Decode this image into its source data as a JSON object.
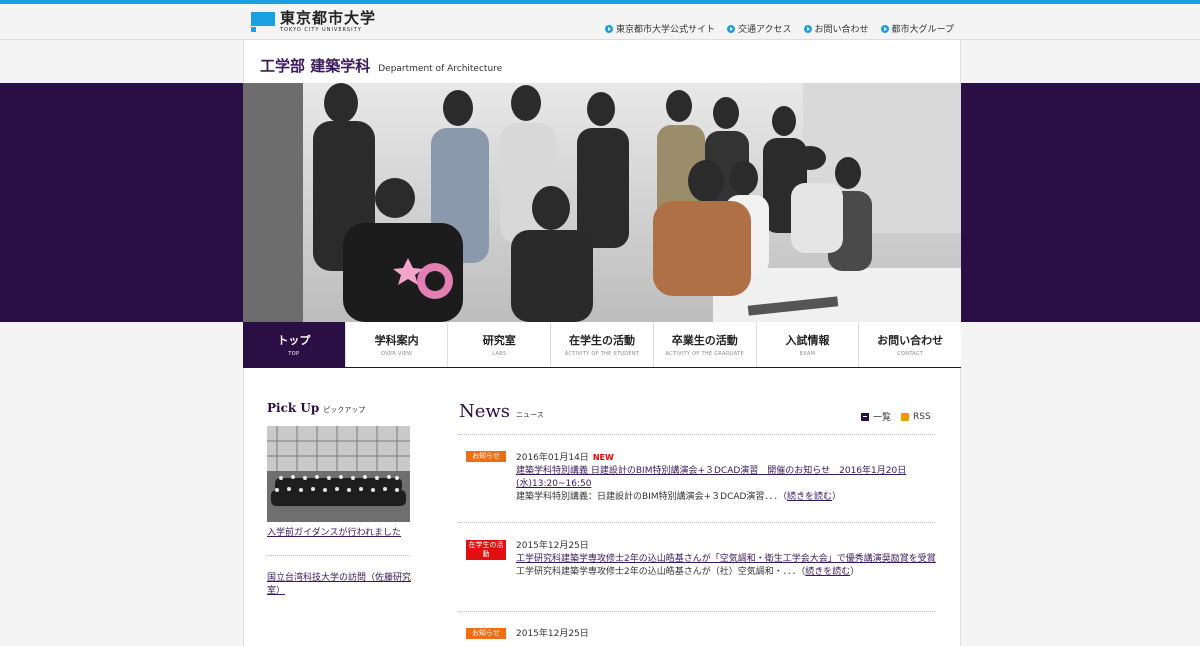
{
  "site": {
    "logo_jp": "東京都市大学",
    "logo_en": "TOKYO CITY UNIVERSITY",
    "top_links": [
      "東京都市大学公式サイト",
      "交通アクセス",
      "お問い合わせ",
      "都市大グループ"
    ]
  },
  "dept": {
    "title_jp": "工学部 建築学科",
    "title_en": "Department of Architecture"
  },
  "nav": [
    {
      "jp": "トップ",
      "en": "TOP"
    },
    {
      "jp": "学科案内",
      "en": "OVER VIEW"
    },
    {
      "jp": "研究室",
      "en": "LABS"
    },
    {
      "jp": "在学生の活動",
      "en": "ACTIVITY OF THE STUDENT"
    },
    {
      "jp": "卒業生の活動",
      "en": "ACTIVITY OF THE GRADUATE"
    },
    {
      "jp": "入試情報",
      "en": "EXAM"
    },
    {
      "jp": "お問い合わせ",
      "en": "CONTACT"
    }
  ],
  "pickup": {
    "title_en": "Pick Up",
    "title_jp": "ピックアップ",
    "items": [
      "入学前ガイダンスが行われました",
      "国立台湾科技大学の訪問（佐藤研究室）"
    ]
  },
  "news": {
    "title_en": "News",
    "title_jp": "ニュース",
    "list_label": "一覧",
    "rss_label": "RSS",
    "items": [
      {
        "badge": "お知らせ",
        "date": "2016年01月14日",
        "new": "NEW",
        "headline": "建築学科特別講義 日建設計のBIM特別講演会+３DCAD演習　開催のお知らせ　2016年1月20日(水)13:20~16:50",
        "summary": "建築学科特別講義：日建設計のBIM特別講演会+３DCAD演習．．．（",
        "readmore": "続きを読む",
        "close": "）"
      },
      {
        "badge": "在学生の活動",
        "date": "2015年12月25日",
        "new": "",
        "headline": "工学研究科建築学専攻修士2年の込山皓基さんが「空気調和・衛生工学会大会」で優秀講演奨励賞を受賞",
        "summary": "工学研究科建築学専攻修士2年の込山皓基さんが（社）空気調和・．．．（",
        "readmore": "続きを読む",
        "close": "）"
      },
      {
        "badge": "お知らせ",
        "date": "2015年12月25日",
        "new": "",
        "headline": "",
        "summary": "",
        "readmore": "",
        "close": ""
      }
    ]
  },
  "colors": {
    "accent": "#1aa0e0",
    "brand_purple": "#2a0f45",
    "badge_orange": "#f06e10",
    "badge_red": "#e01010"
  }
}
